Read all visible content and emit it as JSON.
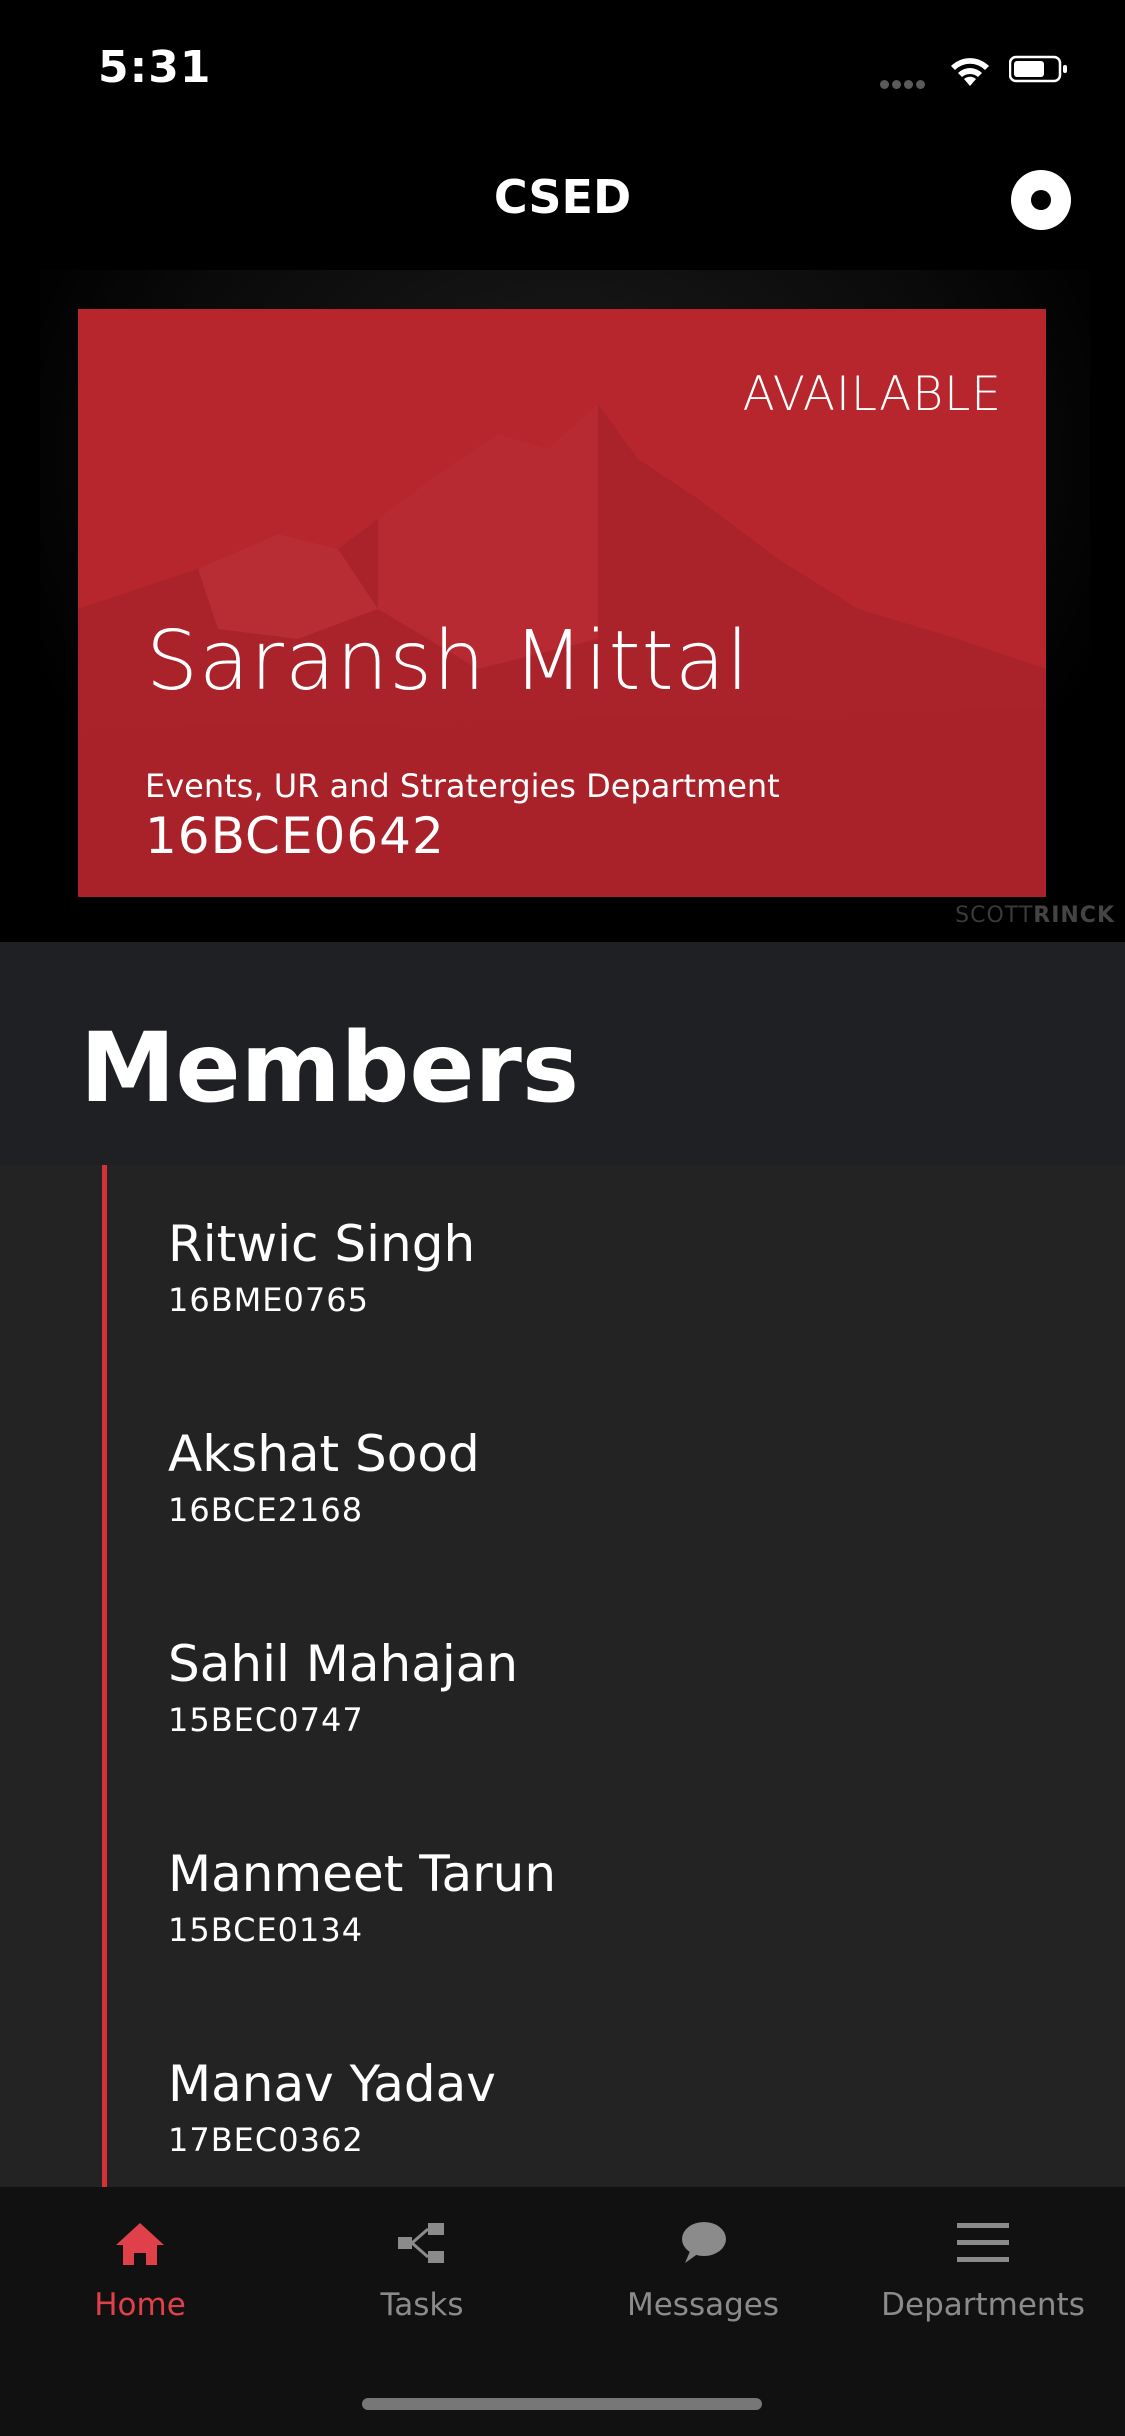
{
  "status_bar": {
    "time": "5:31"
  },
  "nav": {
    "title": "CSED"
  },
  "hero_card": {
    "status": "AVAILABLE",
    "name": "Saransh Mittal",
    "department": "Events, UR and Stratergies Department",
    "id": "16BCE0642",
    "watermark_a": "SCOTT",
    "watermark_b": "RINCK",
    "accent_color": "#b7262c"
  },
  "members": {
    "title": "Members",
    "items": [
      {
        "name": "Ritwic Singh",
        "id": "16BME0765"
      },
      {
        "name": "Akshat Sood",
        "id": "16BCE2168"
      },
      {
        "name": "Sahil Mahajan",
        "id": "15BEC0747"
      },
      {
        "name": "Manmeet Tarun",
        "id": "15BCE0134"
      },
      {
        "name": "Manav Yadav",
        "id": "17BEC0362"
      }
    ]
  },
  "tabbar": {
    "tabs": [
      {
        "label": "Home",
        "icon": "home-icon",
        "active": true
      },
      {
        "label": "Tasks",
        "icon": "tasks-icon",
        "active": false
      },
      {
        "label": "Messages",
        "icon": "messages-icon",
        "active": false
      },
      {
        "label": "Departments",
        "icon": "menu-icon",
        "active": false
      }
    ],
    "active_color": "#e04049",
    "inactive_color": "#8b8b8b"
  }
}
